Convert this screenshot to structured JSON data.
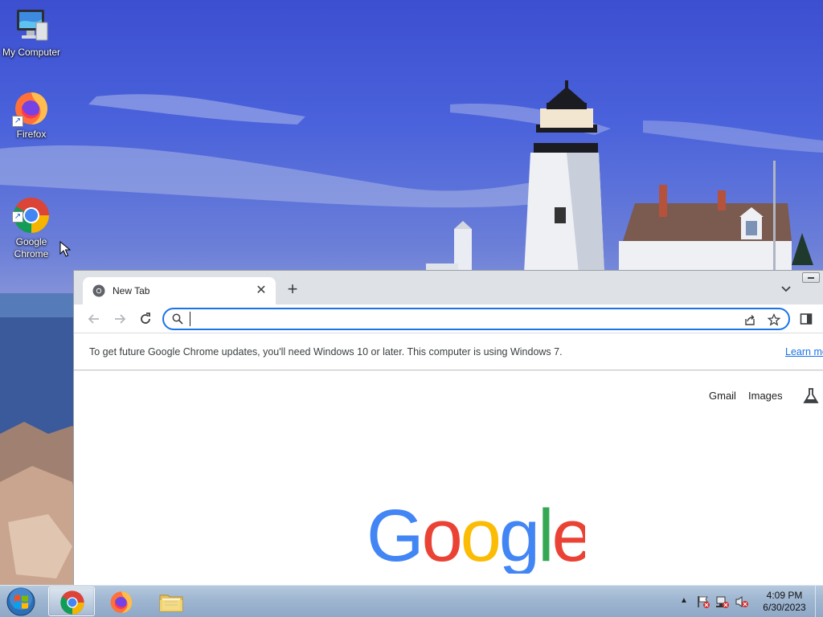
{
  "desktop": {
    "icons": [
      {
        "label": "My Computer",
        "icon": "computer-icon"
      },
      {
        "label": "Firefox",
        "icon": "firefox-icon"
      },
      {
        "label": "Google\nChrome",
        "icon": "chrome-icon"
      }
    ]
  },
  "browser": {
    "tab": {
      "title": "New Tab",
      "close_glyph": "✕"
    },
    "new_tab_glyph": "+",
    "omnibox": {
      "value": "",
      "placeholder": ""
    },
    "infobar": {
      "message": "To get future Google Chrome updates, you'll need Windows 10 or later. This computer is using Windows 7.",
      "link": "Learn more"
    },
    "page": {
      "gmail": "Gmail",
      "images": "Images",
      "logo_letters": [
        "G",
        "o",
        "o",
        "g",
        "l",
        "e"
      ]
    }
  },
  "taskbar": {
    "pinned": [
      "Google Chrome",
      "Firefox",
      "Windows Explorer"
    ],
    "clock": {
      "time": "4:09 PM",
      "date": "6/30/2023"
    }
  },
  "colors": {
    "accent": "#1a73e8",
    "google_blue": "#4285f4",
    "google_red": "#ea4335",
    "google_yellow": "#fbbc05",
    "google_green": "#34a853"
  }
}
